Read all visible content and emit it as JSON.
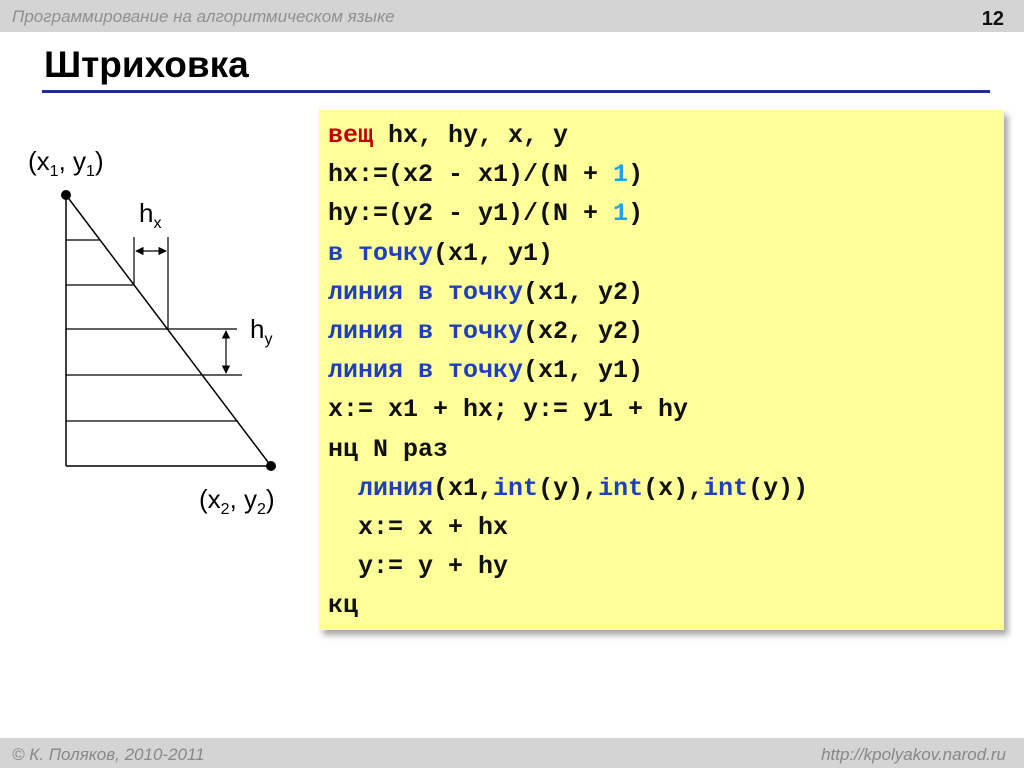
{
  "header": {
    "subject": "Программирование на алгоритмическом языке",
    "slide_number": "12"
  },
  "title": "Штриховка",
  "diagram": {
    "p1": {
      "label_open": "(x",
      "sub1": "1",
      "label_mid": ", y",
      "sub2": "1",
      "label_close": ")"
    },
    "p2": {
      "label_open": "(x",
      "sub1": "2",
      "label_mid": ", y",
      "sub2": "2",
      "label_close": ")"
    },
    "hx": {
      "base": "h",
      "sub": "x"
    },
    "hy": {
      "base": "h",
      "sub": "y"
    }
  },
  "code": {
    "l1": {
      "kw": "вещ",
      "rest": " hx, hy, x, y"
    },
    "l2": {
      "a": "hx:=(x2 - x1)/(N + ",
      "num": "1",
      "b": ")"
    },
    "l3": {
      "a": "hy:=(y2 - y1)/(N + ",
      "num": "1",
      "b": ")"
    },
    "l4": {
      "kw": "в точку",
      "rest": "(x1, y1)"
    },
    "l5": {
      "kw": "линия в точку",
      "rest": "(x1, y2)"
    },
    "l6": {
      "kw": "линия в точку",
      "rest": "(x2, y2)"
    },
    "l7": {
      "kw": "линия в точку",
      "rest": "(x1, y1)"
    },
    "l8": "x:= x1 + hx; y:= y1 + hy",
    "l9": "нц N раз",
    "l10": {
      "indent": "  ",
      "kw1": "линия",
      "a": "(x1,",
      "kw2": "int",
      "b": "(y),",
      "kw3": "int",
      "c": "(x),",
      "kw4": "int",
      "d": "(y))"
    },
    "l11": "  x:= x + hx",
    "l12": "  y:= y + hy",
    "l13": "кц"
  },
  "footer": {
    "author": "© К. Поляков, 2010-2011",
    "url": "http://kpolyakov.narod.ru"
  },
  "colors": {
    "title_rule": "#1f2e8f",
    "code_bg": "#ffff99",
    "keyword_red": "#c00000",
    "keyword_blue": "#1f3fbf",
    "number": "#1aa3ee"
  }
}
